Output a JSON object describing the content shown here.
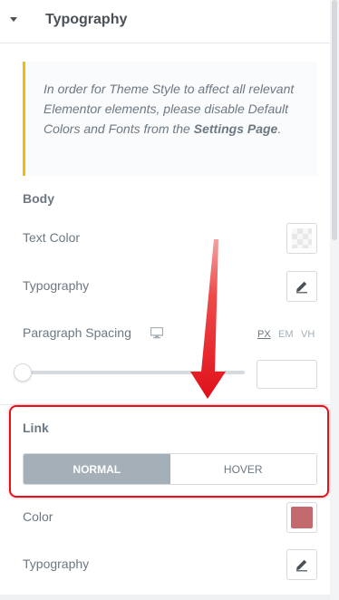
{
  "section": {
    "title": "Typography"
  },
  "notice": {
    "text": "In order for Theme Style to affect all relevant Elementor elements, please disable Default Colors and Fonts from the ",
    "link_text": "Settings Page",
    "suffix": "."
  },
  "body_group": {
    "title": "Body",
    "text_color_label": "Text Color",
    "typography_label": "Typography",
    "paragraph_spacing_label": "Paragraph Spacing",
    "units": [
      "PX",
      "EM",
      "VH"
    ],
    "active_unit": "PX",
    "spacing_value": "",
    "slider_fraction": 0
  },
  "link_group": {
    "title": "Link",
    "tabs": [
      "NORMAL",
      "HOVER"
    ],
    "active_tab": "NORMAL",
    "color_label": "Color",
    "color_value": "#c26a6e",
    "typography_label": "Typography"
  },
  "colors": {
    "notice_border": "#f0c000",
    "highlight": "#e8101a",
    "active_tab_bg": "#a4afb7"
  },
  "icons": {
    "caret": "caret-down-icon",
    "edit": "pencil-icon",
    "responsive": "desktop-monitor-icon",
    "annotation": "red-arrow-icon"
  }
}
